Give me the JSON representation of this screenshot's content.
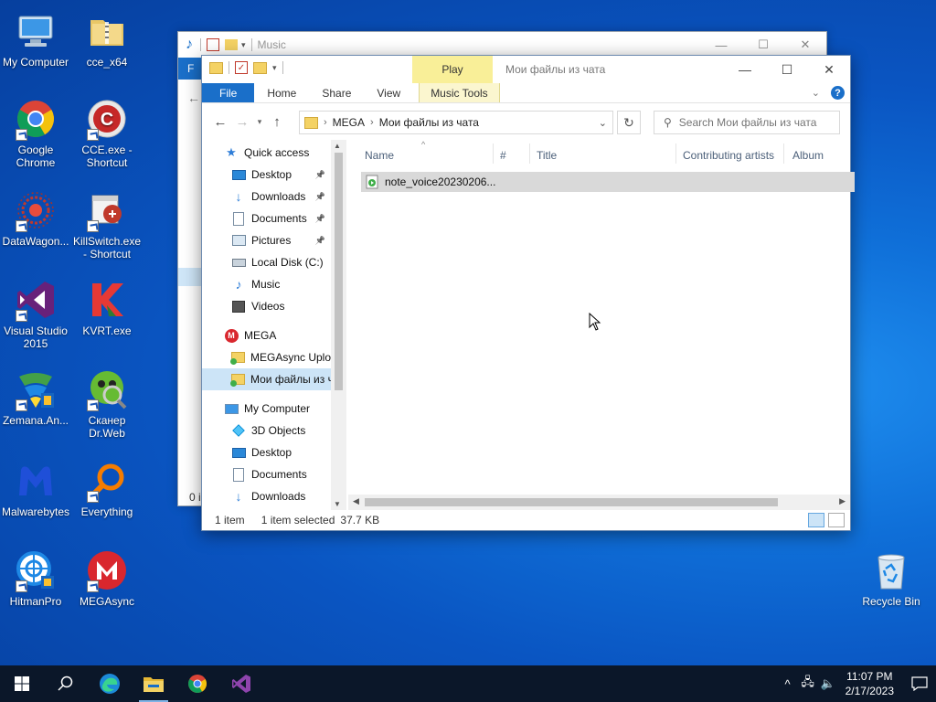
{
  "desktop": {
    "icons": [
      {
        "label": "My Computer"
      },
      {
        "label": "cce_x64"
      },
      {
        "label": "Google Chrome"
      },
      {
        "label": "CCE.exe - Shortcut"
      },
      {
        "label": "DataWagon..."
      },
      {
        "label": "KillSwitch.exe - Shortcut"
      },
      {
        "label": "Visual Studio 2015"
      },
      {
        "label": "KVRT.exe"
      },
      {
        "label": "Zemana.An..."
      },
      {
        "label": "Сканер Dr.Web"
      },
      {
        "label": "Malwarebytes"
      },
      {
        "label": "Everything"
      },
      {
        "label": "HitmanPro"
      },
      {
        "label": "MEGAsync"
      }
    ],
    "recycle_bin": "Recycle Bin"
  },
  "back_window": {
    "title": "Music",
    "file_tab": "F",
    "status": "0 i"
  },
  "window": {
    "title": "Мои файлы из чата",
    "context_tab": "Play",
    "ribbon_tabs": [
      "File",
      "Home",
      "Share",
      "View",
      "Music Tools"
    ],
    "address": {
      "crumbs": [
        "MEGA",
        "Мои файлы из чата"
      ]
    },
    "search": {
      "placeholder": "Search Мои файлы из чата"
    },
    "nav": [
      {
        "label": "Quick access",
        "icon": "star-icon",
        "level": 0
      },
      {
        "label": "Desktop",
        "icon": "desktop-icon",
        "level": 1,
        "pinned": true
      },
      {
        "label": "Downloads",
        "icon": "download-icon",
        "level": 1,
        "pinned": true
      },
      {
        "label": "Documents",
        "icon": "documents-icon",
        "level": 1,
        "pinned": true
      },
      {
        "label": "Pictures",
        "icon": "pictures-icon",
        "level": 1,
        "pinned": true
      },
      {
        "label": "Local Disk (C:)",
        "icon": "drive-icon",
        "level": 1
      },
      {
        "label": "Music",
        "icon": "music-icon",
        "level": 1
      },
      {
        "label": "Videos",
        "icon": "videos-icon",
        "level": 1
      },
      {
        "label": "MEGA",
        "icon": "mega-icon",
        "level": 0
      },
      {
        "label": "MEGAsync Uplo",
        "icon": "folder-icon",
        "level": 1
      },
      {
        "label": "Мои файлы из ч",
        "icon": "folder-icon",
        "level": 1,
        "selected": true
      },
      {
        "label": "My Computer",
        "icon": "computer-icon",
        "level": 0
      },
      {
        "label": "3D Objects",
        "icon": "objects-3d-icon",
        "level": 1
      },
      {
        "label": "Desktop",
        "icon": "desktop-icon",
        "level": 1
      },
      {
        "label": "Documents",
        "icon": "documents-icon",
        "level": 1
      },
      {
        "label": "Downloads",
        "icon": "download-icon",
        "level": 1
      }
    ],
    "columns": [
      "Name",
      "#",
      "Title",
      "Contributing artists",
      "Album"
    ],
    "files": [
      {
        "name": "note_voice20230206..."
      }
    ],
    "status": {
      "count": "1 item",
      "selected": "1 item selected",
      "size": "37.7 KB"
    }
  },
  "taskbar": {
    "time": "11:07 PM",
    "date": "2/17/2023"
  },
  "colors": {
    "accent": "#1a6fc9",
    "selection": "#cce4f7",
    "context_tab": "#f9ef98",
    "taskbar": "#0b1729"
  }
}
